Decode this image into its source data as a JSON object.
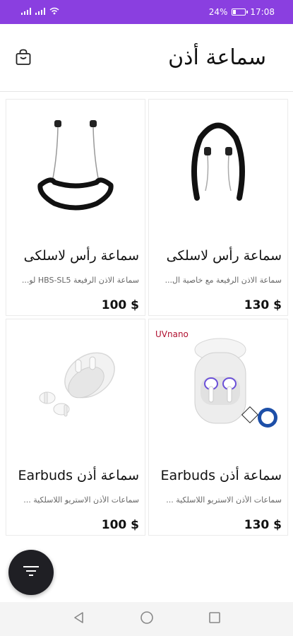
{
  "status_bar": {
    "signal_text": "ill ull ?",
    "battery_percent": "24%",
    "battery_level": 0.24,
    "time": "17:08",
    "icons": [
      "signal-icon",
      "wifi-icon",
      "battery-icon"
    ]
  },
  "header": {
    "title": "سماعة أذن",
    "cart_icon": "shopping-bag-icon"
  },
  "products": [
    {
      "name": "سماعة رأس لاسلكى",
      "description": "سماعة الاذن الرفيعة مع خاصية ال...",
      "price": "130 $",
      "image_icon": "neckband-headphones-icon"
    },
    {
      "name": "سماعة رأس لاسلكى",
      "description": "سماعة الاذن الرفيعة HBS-SL5 لو...",
      "price": "100 $",
      "image_icon": "sport-neckband-headphones-icon"
    },
    {
      "name": "سماعة أذن Earbuds",
      "description": "سماعات الأذن الاستريو اللاسلكية ...",
      "price": "130 $",
      "image_icon": "earbuds-uvnano-case-icon",
      "image_text": "UVnano"
    },
    {
      "name": "سماعة أذن Earbuds",
      "description": "سماعات الأذن الاستريو اللاسلكية ...",
      "price": "100 $",
      "image_icon": "earbuds-white-case-icon"
    }
  ],
  "fab": {
    "icon": "filter-icon"
  },
  "nav_bar": {
    "icons": [
      "back-icon",
      "home-icon",
      "recents-icon"
    ]
  },
  "colors": {
    "status_bar": "#8a3fe0",
    "fab": "#1f1f24",
    "text": "#111111"
  }
}
